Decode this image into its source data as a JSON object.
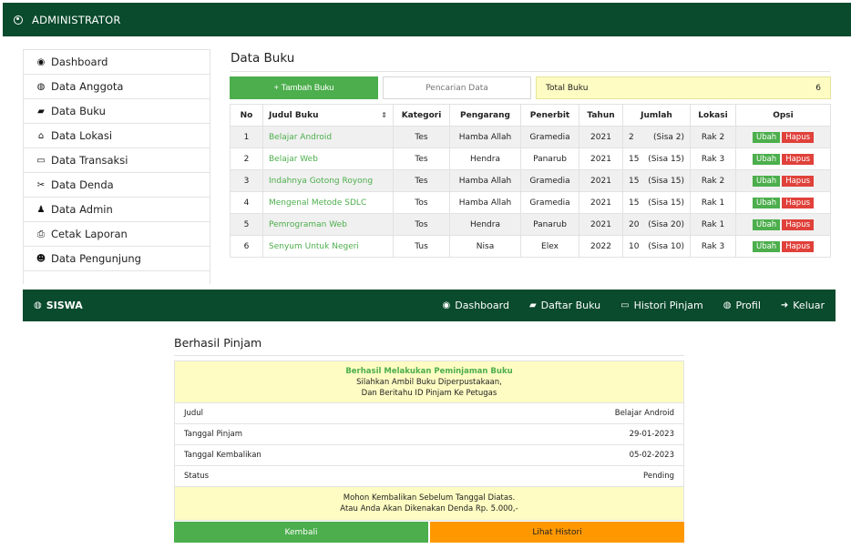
{
  "admin_bar": {
    "title": "ADMINISTRATOR"
  },
  "sidebar": {
    "items": [
      {
        "label": "Dashboard",
        "icon": "dashboard-icon",
        "glyph": "◉"
      },
      {
        "label": "Data Anggota",
        "icon": "user-circle-icon",
        "glyph": "◍"
      },
      {
        "label": "Data Buku",
        "icon": "book-icon",
        "glyph": "▰"
      },
      {
        "label": "Data Lokasi",
        "icon": "bank-icon",
        "glyph": "⌂"
      },
      {
        "label": "Data Transaksi",
        "icon": "credit-card-icon",
        "glyph": "▭"
      },
      {
        "label": "Data Denda",
        "icon": "scissors-icon",
        "glyph": "✂"
      },
      {
        "label": "Data Admin",
        "icon": "user-secret-icon",
        "glyph": "♟"
      },
      {
        "label": "Cetak Laporan",
        "icon": "print-icon",
        "glyph": "⎙"
      },
      {
        "label": "Data Pengunjung",
        "icon": "users-icon",
        "glyph": "☻"
      }
    ]
  },
  "main": {
    "title": "Data Buku",
    "add_button": "+ Tambah Buku",
    "search_placeholder": "Pencarian Data",
    "total_label": "Total Buku",
    "total_value": "6",
    "columns": [
      "No",
      "Judul Buku",
      "Kategori",
      "Pengarang",
      "Penerbit",
      "Tahun",
      "Jumlah",
      "Lokasi",
      "Opsi"
    ],
    "sort_glyph": "⇕",
    "edit_label": "Ubah",
    "delete_label": "Hapus",
    "rows": [
      {
        "no": "1",
        "judul": "Belajar Android",
        "kategori": "Tes",
        "pengarang": "Hamba Allah",
        "penerbit": "Gramedia",
        "tahun": "2021",
        "jumlah": "2",
        "sisa": "(Sisa 2)",
        "lokasi": "Rak 2"
      },
      {
        "no": "2",
        "judul": "Belajar Web",
        "kategori": "Tes",
        "pengarang": "Hendra",
        "penerbit": "Panarub",
        "tahun": "2021",
        "jumlah": "15",
        "sisa": "(Sisa 15)",
        "lokasi": "Rak 3"
      },
      {
        "no": "3",
        "judul": "Indahnya Gotong Royong",
        "kategori": "Tes",
        "pengarang": "Hamba Allah",
        "penerbit": "Gramedia",
        "tahun": "2021",
        "jumlah": "15",
        "sisa": "(Sisa 15)",
        "lokasi": "Rak 2"
      },
      {
        "no": "4",
        "judul": "Mengenal Metode SDLC",
        "kategori": "Tos",
        "pengarang": "Hamba Allah",
        "penerbit": "Gramedia",
        "tahun": "2021",
        "jumlah": "15",
        "sisa": "(Sisa 15)",
        "lokasi": "Rak 1"
      },
      {
        "no": "5",
        "judul": "Pemrograman Web",
        "kategori": "Tos",
        "pengarang": "Hendra",
        "penerbit": "Panarub",
        "tahun": "2021",
        "jumlah": "20",
        "sisa": "(Sisa 20)",
        "lokasi": "Rak 1"
      },
      {
        "no": "6",
        "judul": "Senyum Untuk Negeri",
        "kategori": "Tus",
        "pengarang": "Nisa",
        "penerbit": "Elex",
        "tahun": "2022",
        "jumlah": "10",
        "sisa": "(Sisa 10)",
        "lokasi": "Rak 3"
      }
    ]
  },
  "siswa_bar": {
    "brand": "SISWA",
    "nav": [
      {
        "label": "Dashboard",
        "icon": "dashboard-icon",
        "glyph": "◉"
      },
      {
        "label": "Daftar Buku",
        "icon": "book-icon",
        "glyph": "▰"
      },
      {
        "label": "Histori Pinjam",
        "icon": "credit-card-icon",
        "glyph": "▭"
      },
      {
        "label": "Profil",
        "icon": "user-circle-icon",
        "glyph": "◍"
      },
      {
        "label": "Keluar",
        "icon": "sign-out-icon",
        "glyph": "➜"
      }
    ]
  },
  "success": {
    "title": "Berhasil Pinjam",
    "heading": "Berhasil Melakukan Peminjaman Buku",
    "line1": "Silahkan Ambil Buku Diperpustakaan,",
    "line2": "Dan Beritahu ID Pinjam Ke Petugas",
    "fields": [
      {
        "label": "Judul",
        "value": "Belajar Android"
      },
      {
        "label": "Tanggal Pinjam",
        "value": "29-01-2023"
      },
      {
        "label": "Tanggal Kembalikan",
        "value": "05-02-2023"
      },
      {
        "label": "Status",
        "value": "Pending"
      }
    ],
    "footer1": "Mohon Kembalikan Sebelum Tanggal Diatas.",
    "footer2": "Atau Anda Akan Dikenakan Denda Rp. 5.000,-",
    "back_button": "Kembali",
    "history_button": "Lihat Histori"
  },
  "colors": {
    "brand_green": "#0a4a2d",
    "success_green": "#4cae4c",
    "danger_red": "#e0413a",
    "warning_orange": "#ff9800",
    "highlight_yellow": "#fefcc2"
  }
}
